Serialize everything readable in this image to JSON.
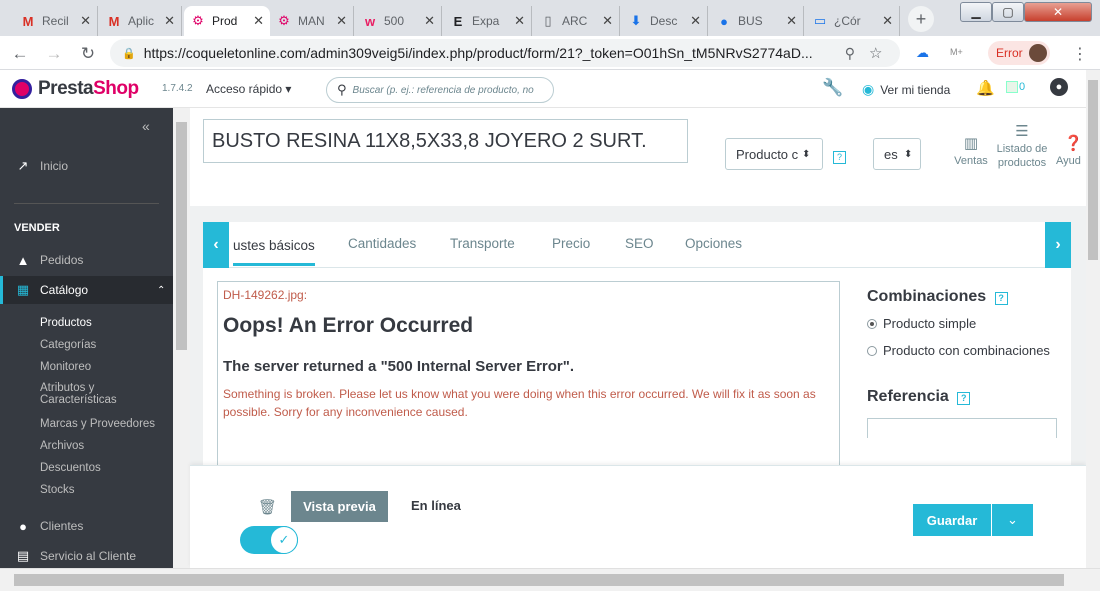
{
  "browser": {
    "tabs": [
      {
        "icon": "M",
        "title": "Recil",
        "color": "#d93025"
      },
      {
        "icon": "M",
        "title": "Aplic",
        "color": "#d93025"
      },
      {
        "icon": "ps",
        "title": "Prod",
        "color": "#df0067",
        "active": true
      },
      {
        "icon": "ps",
        "title": "MAN",
        "color": "#df0067"
      },
      {
        "icon": "w",
        "title": "500",
        "color": "#e91e63"
      },
      {
        "icon": "E",
        "title": "Expa",
        "color": "#202124"
      },
      {
        "icon": "doc",
        "title": "ARC",
        "color": "#5f6368"
      },
      {
        "icon": "dl",
        "title": "Desc",
        "color": "#1a73e8"
      },
      {
        "icon": "gh",
        "title": "BUS",
        "color": "#1a73e8"
      },
      {
        "icon": "kbd",
        "title": "¿Cór",
        "color": "#1a73e8"
      }
    ],
    "url": "https://coqueletonline.com/admin309veig5i/index.php/product/form/21?_token=O01hSn_tM5NRvS2774aD...",
    "error_label": "Error"
  },
  "header": {
    "brand_pre": "Presta",
    "brand_post": "Shop",
    "version": "1.7.4.2",
    "quick_access": "Acceso rápido ▾",
    "search_placeholder": "Buscar (p. ej.: referencia de producto, no",
    "view_store": "Ver mi tienda",
    "broken_img": "0"
  },
  "sidebar": {
    "collapse": "«",
    "home": "Inicio",
    "section_sell": "VENDER",
    "orders": "Pedidos",
    "catalog": "Catálogo",
    "catalog_items": [
      "Productos",
      "Categorías",
      "Monitoreo",
      "Atributos y Características",
      "Marcas y Proveedores",
      "Archivos",
      "Descuentos",
      "Stocks"
    ],
    "customers": "Clientes",
    "service": "Servicio al Cliente"
  },
  "product": {
    "name": "BUSTO RESINA 11X8,5X33,8 JOYERO 2 SURT.",
    "type_select": "Producto c",
    "lang_select": "es",
    "toolbar": {
      "sales": "Ventas",
      "list": "Listado de productos",
      "help": "Ayud"
    }
  },
  "tabs": [
    "ustes básicos",
    "Cantidades",
    "Transporte",
    "Precio",
    "SEO",
    "Opciones"
  ],
  "error": {
    "file": "DH-149262.jpg:",
    "title": "Oops! An Error Occurred",
    "subtitle": "The server returned a \"500 Internal Server Error\".",
    "message": "Something is broken. Please let us know what you were doing when this error occurred. We will fix it as soon as possible. Sorry for any inconvenience caused."
  },
  "right": {
    "combinations_title": "Combinaciones",
    "simple": "Producto simple",
    "with_combinations": "Producto con combinaciones",
    "reference_title": "Referencia"
  },
  "footer": {
    "preview": "Vista previa",
    "online": "En línea",
    "save": "Guardar"
  }
}
